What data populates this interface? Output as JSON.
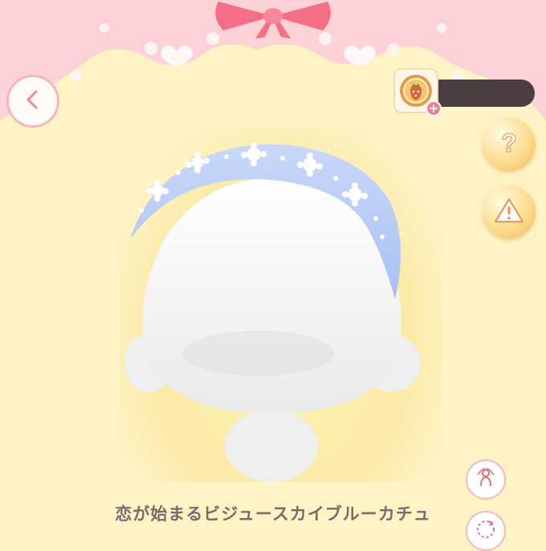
{
  "item": {
    "name": "恋が始まるビジュースカイブルーカチュ"
  },
  "currency": {
    "icon": "strawberry-coin-icon",
    "plus_icon": "plus-icon"
  },
  "buttons": {
    "back_icon": "chevron-left-icon",
    "help_icon": "question-icon",
    "warning_icon": "warning-icon",
    "pose_icon": "pose-icon",
    "random_icon": "random-icon"
  },
  "colors": {
    "background": "#fdf3c4",
    "header_pink": "#fcd2d6",
    "headband": "#b8ccf5",
    "ribbon": "#f36e86"
  }
}
